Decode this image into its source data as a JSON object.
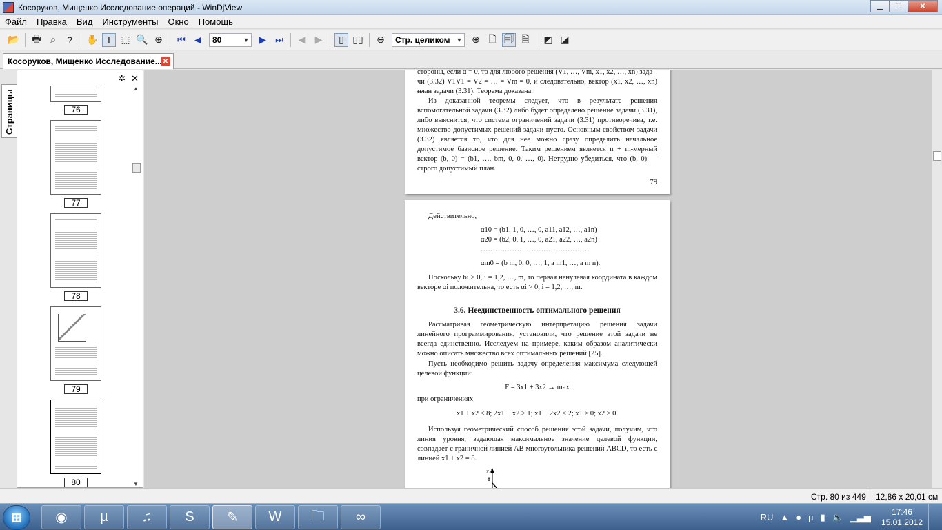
{
  "window": {
    "title": "Косоруков, Мищенко Исследование операций - WinDjView"
  },
  "menu": [
    "Файл",
    "Правка",
    "Вид",
    "Инструменты",
    "Окно",
    "Помощь"
  ],
  "toolbar": {
    "page_value": "80",
    "zoom_value": "Стр. целиком"
  },
  "tab": {
    "label": "Косоруков, Мищенко Исследование..."
  },
  "sidebar": {
    "vertical_tab": "Страницы",
    "thumbnails": [
      "76",
      "77",
      "78",
      "79",
      "80"
    ]
  },
  "page79": {
    "lines": [
      "стороны, если α = 0, то для любого решения (V1, …, Vm, x1, x2, …, xn) зада-",
      "чи (3.32) V1V1 = V2 = … = Vm = 0, и следовательно, вектор (x1, x2, …, xn) —",
      "план задачи (3.31). Теорема доказана."
    ],
    "paragraph": "Из доказанной теоремы следует, что в результате решения вспомогательной задачи (3.32) либо будет определено решение задачи (3.31), либо выяснится, что система ограничений задачи (3.31) противоречива, т.е. множество допустимых решений задачи пусто. Основным свойством задачи (3.32) является то, что для нее можно сразу определить начальное допустимое базисное решение. Таким решением является n + m-мерный вектор (b, 0) = (b1, …, bm, 0, 0, …, 0). Нетрудно убедиться, что (b, 0) — строго допустимый план.",
    "number": "79"
  },
  "page80": {
    "intro": "Действительно,",
    "eq1": "α10 = (b1, 1, 0, …, 0, a11, a12, …, a1n)",
    "eq2": "α20 = (b2, 0, 1, …, 0, a21, a22, …, a2n)",
    "dots": "………………………………………",
    "eq3": "αm0 = (b m, 0, 0, …, 1, a m1, …, a m n).",
    "p1": "Поскольку bi ≥ 0, i = 1,2, …, m, то первая ненулевая координата в каждом векторе αi положительна, то есть αi > 0, i = 1,2, …, m.",
    "heading": "3.6. Неединственность оптимального решения",
    "p2": "Рассматривая геометрическую интерпретацию решения задачи линейного программирования, установили, что решение этой задачи не всегда единственно. Исследуем на примере, каким образом аналитически можно описать множество всех оптимальных решений [25].",
    "p3": "Пусть необходимо решить задачу определения максимума следующей целевой функции:",
    "eq_f": "F = 3x1 + 3x2 → max",
    "constraints_label": "при ограничениях",
    "eq_c": "x1 + x2 ≤ 8; 2x1 − x2 ≥ 1; x1 − 2x2 ≤ 2; x1 ≥ 0; x2 ≥ 0.",
    "p4": "Используя геометрический способ решения этой задачи, получим, что линия уровня, задающая максимальное значение целевой функции, совпадает с граничной линией AB многоугольника решений ABCD, то есть с линией x1 + x2 = 8.",
    "fig_x2": "x2",
    "fig_8": "8"
  },
  "status": {
    "page": "Стр. 80 из 449",
    "size": "12,86 x 20,01 см"
  },
  "taskbar": {
    "lang": "RU",
    "time": "17:46",
    "date": "15.01.2012"
  }
}
